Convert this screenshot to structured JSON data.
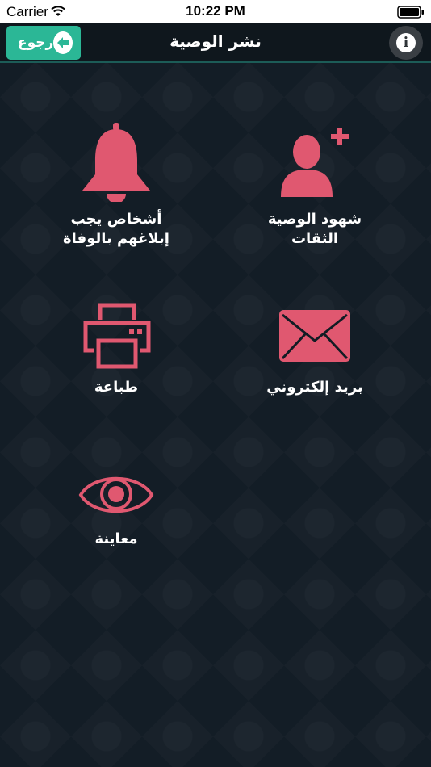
{
  "status_bar": {
    "carrier": "Carrier",
    "time": "10:22 PM"
  },
  "nav": {
    "title": "نشر الوصية",
    "back_label": "رجوع",
    "info_glyph": "i"
  },
  "tiles": [
    {
      "key": "witnesses",
      "label": "شهود الوصية\nالثقات",
      "icon": "add-person-icon"
    },
    {
      "key": "notify",
      "label": "أشخاص يجب\nإبلاغهم بالوفاة",
      "icon": "bell-icon"
    },
    {
      "key": "email",
      "label": "بريد إلكتروني",
      "icon": "envelope-icon"
    },
    {
      "key": "print",
      "label": "طباعة",
      "icon": "printer-icon"
    },
    {
      "key": "preview",
      "label": "معاينة",
      "icon": "eye-icon"
    }
  ],
  "colors": {
    "accent": "#2bb796",
    "icon": "#e05870",
    "background": "#121c24"
  }
}
